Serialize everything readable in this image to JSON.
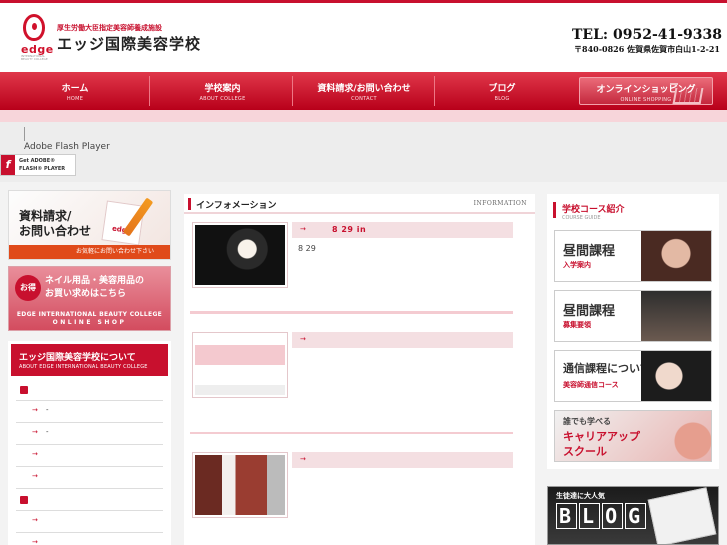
{
  "header": {
    "logo_word": "edge",
    "logo_sub": "INTERNATIONAL BEAUTY COLLEGE",
    "designation": "厚生労働大臣指定美容師養成施設",
    "school_name": "エッジ国際美容学校",
    "tel": "TEL: 0952-41-9338",
    "address": "〒840-0826 佐賀県佐賀市白山1-2-21"
  },
  "nav": {
    "items": [
      {
        "jp": "ホーム",
        "en": "HOME"
      },
      {
        "jp": "学校案内",
        "en": "ABOUT COLLEGE"
      },
      {
        "jp": "資料請求/お問い合わせ",
        "en": "CONTACT"
      },
      {
        "jp": "ブログ",
        "en": "BLOG"
      },
      {
        "jp": "オンラインショッピング",
        "en": "ONLINE SHOPPING"
      }
    ]
  },
  "flash": {
    "label": "Adobe Flash Player",
    "badge_line1": "Get ADOBE®",
    "badge_line2": "FLASH® PLAYER"
  },
  "left": {
    "request_banner": {
      "line1": "資料請求/",
      "line2": "お問い合わせ",
      "bar": "お気軽にお問い合わせ下さい"
    },
    "shop_banner": {
      "badge": "お得",
      "line1": "ネイル用品・美容用品の",
      "line2": "お買い求めはこちら",
      "line3": "EDGE INTERNATIONAL BEAUTY COLLEGE",
      "line4": "ONLINE SHOP"
    },
    "about": {
      "title": "エッジ国際美容学校について",
      "subtitle": "ABOUT EDGE INTERNATIONAL BEAUTY COLLEGE",
      "rows": [
        {
          "type": "category",
          "text": ""
        },
        {
          "type": "link",
          "arrow": "→",
          "text": "-"
        },
        {
          "type": "link",
          "arrow": "→",
          "text": "-"
        },
        {
          "type": "link",
          "arrow": "→",
          "text": ""
        },
        {
          "type": "link",
          "arrow": "→",
          "text": ""
        },
        {
          "type": "category",
          "text": ""
        },
        {
          "type": "link",
          "arrow": "→",
          "text": ""
        },
        {
          "type": "link",
          "arrow": "→",
          "text": ""
        }
      ]
    }
  },
  "center": {
    "title": "インフォメーション",
    "title_en": "INFORMATION",
    "entries": [
      {
        "arrow": "→",
        "title": "8 29 in",
        "date": "8 29"
      },
      {
        "arrow": "→",
        "title": "",
        "date": ""
      },
      {
        "arrow": "→",
        "title": "",
        "date": ""
      }
    ]
  },
  "right": {
    "title": "学校コース紹介",
    "title_en": "COURSE GUIDE",
    "courses": [
      {
        "jp": "昼間課程",
        "sub": "入学案内"
      },
      {
        "jp": "昼間課程",
        "sub": "募集要領"
      },
      {
        "jp": "通信課程について",
        "sub": "美容師通信コース"
      }
    ],
    "career": {
      "small": "誰でも学べる",
      "big1": "キャリアアップ",
      "big2": "スクール"
    },
    "blog": {
      "tag": "生徒達に大人気",
      "letters": [
        "B",
        "L",
        "O",
        "G"
      ]
    }
  },
  "colors": {
    "brand_red": "#c8102e",
    "accent_orange": "#e04a1a",
    "pink_light": "#f4dfe2"
  }
}
